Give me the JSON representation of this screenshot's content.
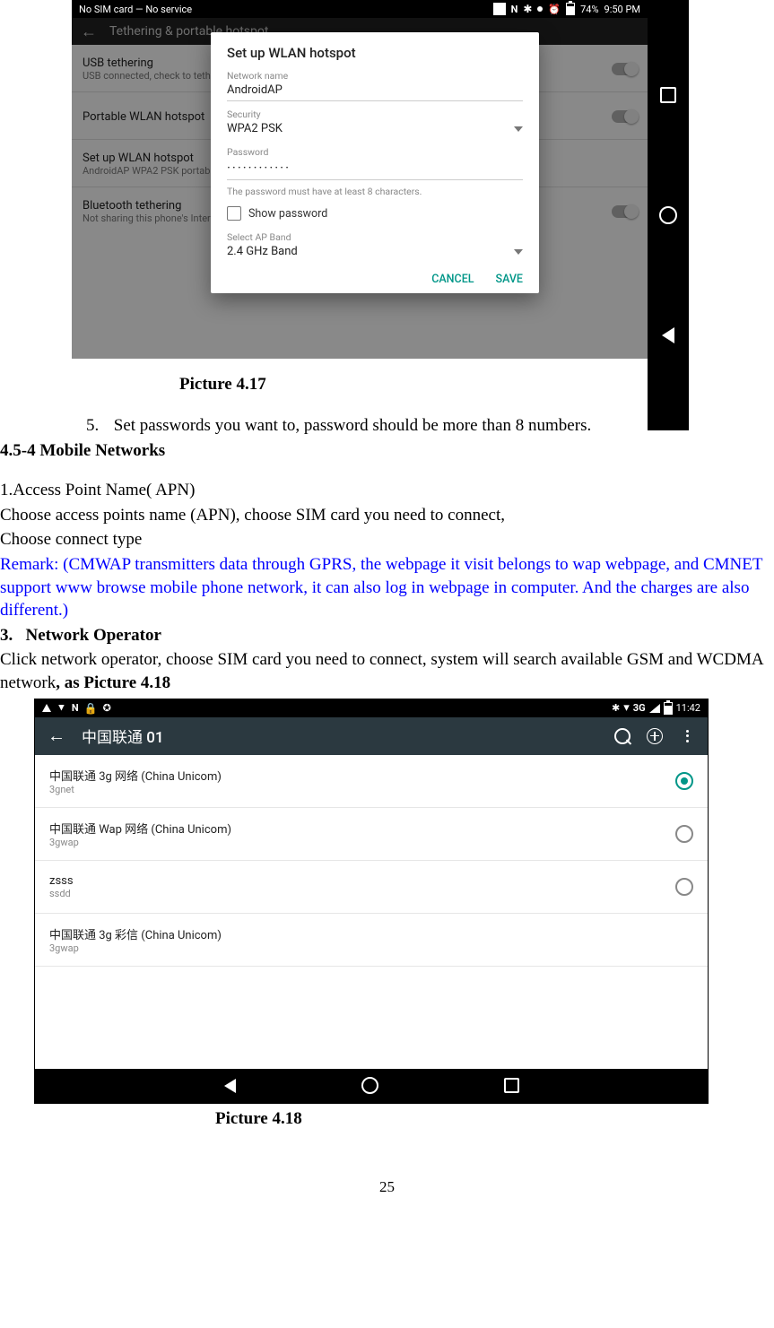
{
  "fig1": {
    "statusbar": {
      "left_text": "No SIM card — No service",
      "battery_pct": "74%",
      "clock": "9:50 PM"
    },
    "toolbar": {
      "title": "Tethering & portable hotspot"
    },
    "items": [
      {
        "title": "USB tethering",
        "subtitle": "USB connected, check to teth"
      },
      {
        "title": "Portable WLAN hotspot",
        "subtitle": ""
      },
      {
        "title": "Set up WLAN hotspot",
        "subtitle": "AndroidAP WPA2 PSK portab"
      },
      {
        "title": "Bluetooth tethering",
        "subtitle": "Not sharing this phone's Inter"
      }
    ],
    "dialog": {
      "title": "Set up WLAN hotspot",
      "network_name_label": "Network name",
      "network_name_value": "AndroidAP",
      "security_label": "Security",
      "security_value": "WPA2 PSK",
      "password_label": "Password",
      "password_value": "············",
      "password_hint": "The password must have at least 8 characters.",
      "show_password_label": "Show password",
      "ap_band_label": "Select AP Band",
      "ap_band_value": "2.4 GHz Band",
      "cancel": "CANCEL",
      "save": "SAVE"
    }
  },
  "captions": {
    "pic417": "Picture 4.17",
    "pic418": "Picture 4.18"
  },
  "body": {
    "step5_num": "5.",
    "step5": "Set passwords you want to, password should be more than 8 numbers.",
    "sec454": "4.5-4 Mobile Networks",
    "apn_h": "1.Access Point Name( APN)",
    "apn_l1": "Choose access points name (APN), choose SIM card you need to connect,",
    "apn_l2": "Choose connect type",
    "remark": "Remark: (CMWAP transmitters data through GPRS, the webpage it visit belongs to wap webpage, and CMNET support www browse mobile phone network, it can also log in webpage in computer. And the charges are also different.)",
    "netop_num": "3.",
    "netop_h": "Network Operator",
    "netop_p": "Click network operator, choose SIM card you need to connect, system will search available GSM and WCDMA network",
    "netop_ref": ", as Picture 4.18"
  },
  "fig2": {
    "statusbar": {
      "clock": "11:42",
      "net": "3G"
    },
    "toolbar": {
      "title": "中国联通 01"
    },
    "apns": [
      {
        "title": "中国联通 3g 网络 (China Unicom)",
        "sub": "3gnet",
        "selected": true,
        "radio": true
      },
      {
        "title": "中国联通 Wap 网络 (China Unicom)",
        "sub": "3gwap",
        "selected": false,
        "radio": true
      },
      {
        "title": "zsss",
        "sub": "ssdd",
        "selected": false,
        "radio": true
      },
      {
        "title": "中国联通 3g 彩信 (China Unicom)",
        "sub": "3gwap",
        "selected": false,
        "radio": false
      }
    ]
  },
  "page_number": "25"
}
